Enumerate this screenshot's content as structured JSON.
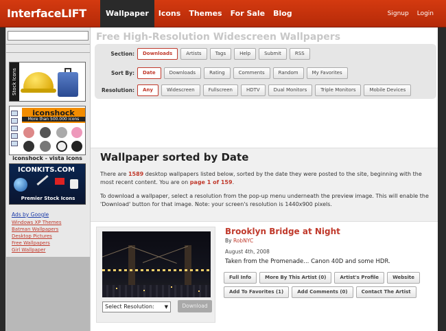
{
  "header": {
    "logo": "InterfaceLIFT",
    "nav": [
      "Wallpaper",
      "Icons",
      "Themes",
      "For Sale",
      "Blog"
    ],
    "active_nav": "Wallpaper",
    "signup": "Signup",
    "login": "Login"
  },
  "sidebar": {
    "ad1_strip": "Stock Icons",
    "ad2_title": "iconshock",
    "ad2_sub": "More than 500.000 icons",
    "ad2_caption": "iconshock - vista icons",
    "ad3_title": "ICONKITS.COM",
    "ad3_sub": "Premier Stock Icons",
    "ads_heading": "Ads by Google",
    "ads_links": [
      "Windows XP Themes",
      "Batman Wallpapers",
      "Desktop Pictures",
      "Free Wallpapers",
      "Girl Wallpaper"
    ]
  },
  "main": {
    "title": "Free High-Resolution Widescreen Wallpapers",
    "section_label": "Section:",
    "section_buttons": [
      "Downloads",
      "Artists",
      "Tags",
      "Help",
      "Submit",
      "RSS"
    ],
    "sort_label": "Sort By:",
    "sort_buttons": [
      "Date",
      "Downloads",
      "Rating",
      "Comments",
      "Random",
      "My Favorites"
    ],
    "resolution_label": "Resolution:",
    "resolution_buttons": [
      "Any",
      "Widescreen",
      "Fullscreen",
      "HDTV",
      "Dual Monitors",
      "Triple Monitors",
      "Mobile Devices"
    ],
    "heading": "Wallpaper sorted by Date",
    "p1_a": "There are ",
    "p1_count": "1589",
    "p1_b": " desktop wallpapers listed below, sorted by the date they were posted to the site, beginning with the most recent content. You are on ",
    "p1_page": "page 1 of 159",
    "p1_c": ".",
    "p2": "To download a wallpaper, select a resolution from the pop-up menu underneath the preview image. This will enable the 'Download' button for that image. Note: your screen's resolution is 1440x900 pixels."
  },
  "wallpaper": {
    "title": "Brooklyn Bridge at Night",
    "by_label": "By ",
    "author": "RobNYC",
    "date": "August 4th, 2008",
    "description": "Taken from the Promenade... Canon 40D and some HDR.",
    "select_label": "Select Resolution:",
    "download": "Download",
    "actions_row1": [
      "Full Info",
      "More By This Artist (0)",
      "Artist's Profile",
      "Website"
    ],
    "actions_row2": [
      "Add To Favorites (1)",
      "Add Comments (0)",
      "Contact The Artist"
    ]
  },
  "colors": {
    "accent": "#c0392b",
    "header": "#c8350c",
    "dark_bg": "#2a2a2a"
  }
}
